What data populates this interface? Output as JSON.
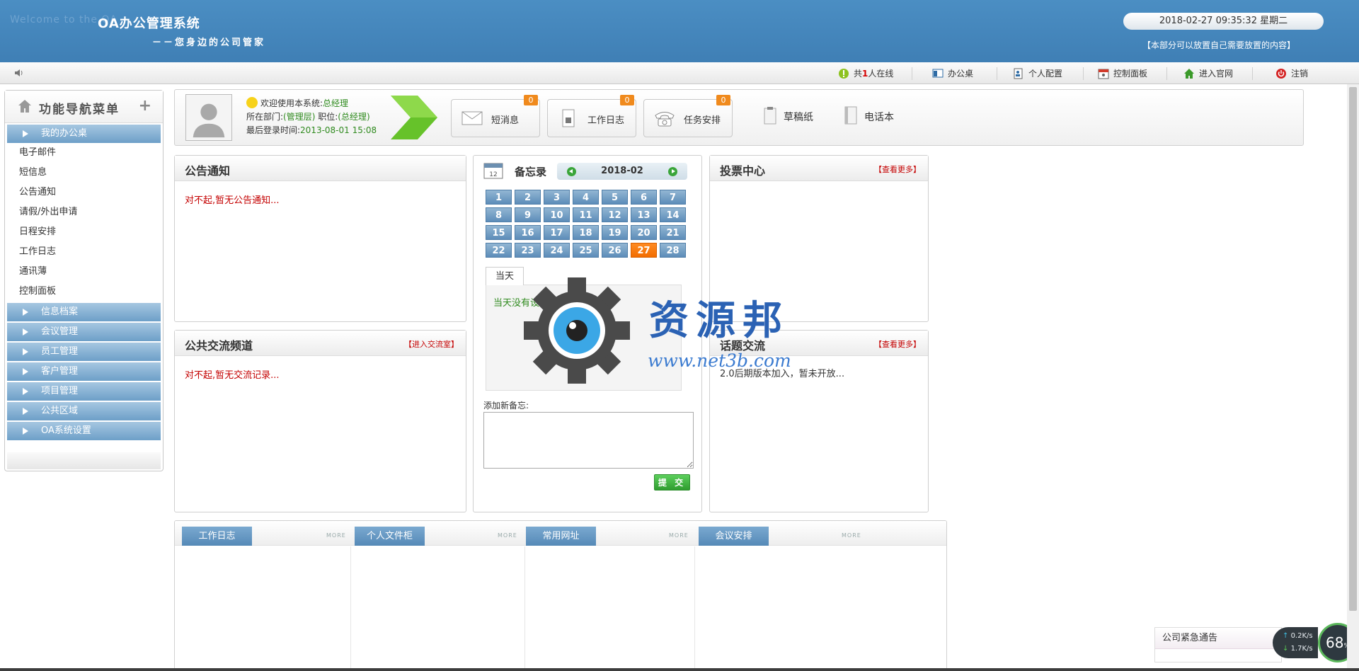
{
  "header": {
    "ghost_text": "Welcome to the OA",
    "title": "OA办公管理系统",
    "subtitle": "－－您身边的公司管家",
    "clock": "2018-02-27 09:35:32 星期二",
    "note": "【本部分可以放置自己需要放置的内容】"
  },
  "toolbar": {
    "online_prefix": "共",
    "online_count": "1",
    "online_suffix": "人在线",
    "items": [
      {
        "label": "办公桌",
        "icon": "desk-icon"
      },
      {
        "label": "个人配置",
        "icon": "user-config-icon"
      },
      {
        "label": "控制面板",
        "icon": "calendar-icon"
      },
      {
        "label": "进入官网",
        "icon": "home-icon"
      },
      {
        "label": "注销",
        "icon": "power-icon"
      }
    ]
  },
  "sidebar": {
    "title": "功能导航菜单",
    "first_category": "我的办公桌",
    "links": [
      "电子邮件",
      "短信息",
      "公告通知",
      "请假/外出申请",
      "日程安排",
      "工作日志",
      "通讯薄",
      "控制面板"
    ],
    "categories": [
      "信息档案",
      "会议管理",
      "员工管理",
      "客户管理",
      "项目管理",
      "公共区域",
      "OA系统设置"
    ]
  },
  "user": {
    "welcome_prefix": "欢迎使用本系统:",
    "name": "总经理",
    "dept_prefix": "所在部门:",
    "dept": "(管理层)",
    "position_prefix": "职位:",
    "position": "(总经理)",
    "last_login_prefix": "最后登录时间:",
    "last_login": "2013-08-01 15:08"
  },
  "quick": [
    {
      "label": "短消息",
      "badge": "0",
      "icon": "envelope-icon"
    },
    {
      "label": "工作日志",
      "badge": "0",
      "icon": "log-icon"
    },
    {
      "label": "任务安排",
      "badge": "0",
      "icon": "phone-icon"
    }
  ],
  "quick_links": [
    {
      "label": "草稿纸",
      "icon": "draft-icon"
    },
    {
      "label": "电话本",
      "icon": "phonebook-icon"
    }
  ],
  "notice": {
    "title": "公告通知",
    "empty": "对不起,暂无公告通知..."
  },
  "exchange": {
    "title": "公共交流频道",
    "more": "【进入交流室】",
    "empty": "对不起,暂无交流记录..."
  },
  "memo": {
    "title": "备忘录",
    "month": "2018-02",
    "days": [
      "1",
      "2",
      "3",
      "4",
      "5",
      "6",
      "7",
      "8",
      "9",
      "10",
      "11",
      "12",
      "13",
      "14",
      "15",
      "16",
      "17",
      "18",
      "19",
      "20",
      "21",
      "22",
      "23",
      "24",
      "25",
      "26",
      "27",
      "28"
    ],
    "today_index": 26,
    "today_tab": "当天",
    "today_msg": "当天没有设置备忘录信息",
    "add_label": "添加新备忘:",
    "submit": "提 交",
    "today_color": "#f26d00"
  },
  "vote": {
    "title": "投票中心",
    "more": "【查看更多】"
  },
  "topic": {
    "title": "话题交流",
    "more": "【查看更多】",
    "text": "2.0后期版本加入，暂未开放..."
  },
  "bottom_tabs": [
    {
      "label": "工作日志",
      "more": "MORE"
    },
    {
      "label": "个人文件柜",
      "more": "MORE"
    },
    {
      "label": "常用网址",
      "more": "MORE"
    },
    {
      "label": "会议安排",
      "more": "MORE"
    }
  ],
  "urgent": {
    "title": "公司紧急通告"
  },
  "net": {
    "up": "0.2K/s",
    "down": "1.7K/s",
    "pct": "68",
    "pct_unit": "%"
  },
  "watermark": {
    "text": "资源邦",
    "url": "www.net3b.com"
  }
}
